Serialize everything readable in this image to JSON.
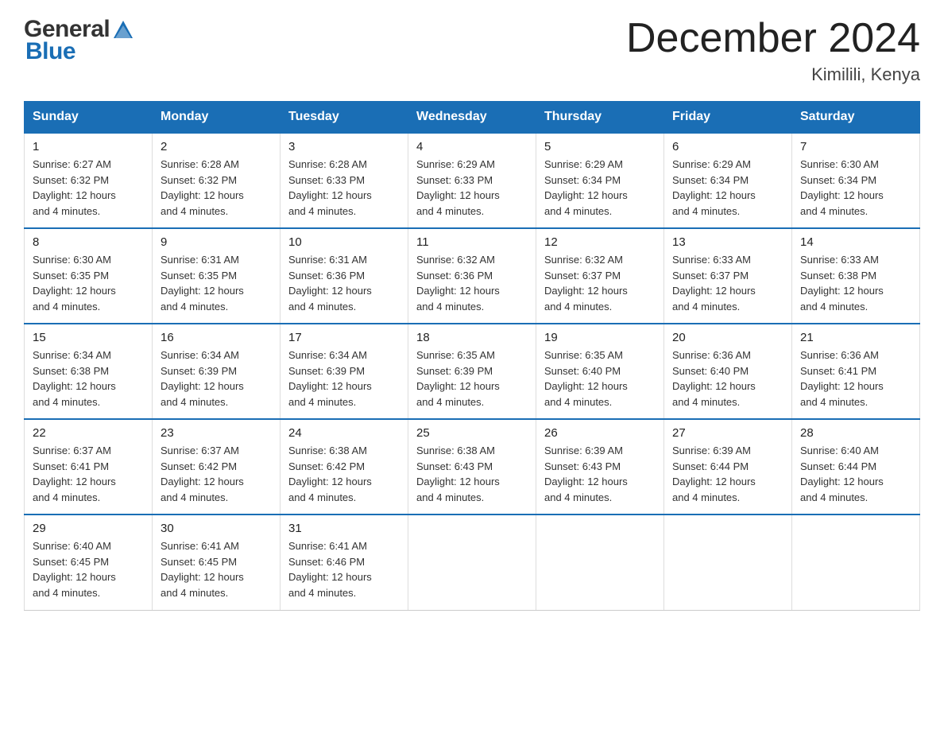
{
  "header": {
    "logo_general": "General",
    "logo_blue": "Blue",
    "month_title": "December 2024",
    "location": "Kimilili, Kenya"
  },
  "days_of_week": [
    "Sunday",
    "Monday",
    "Tuesday",
    "Wednesday",
    "Thursday",
    "Friday",
    "Saturday"
  ],
  "weeks": [
    [
      {
        "day": "1",
        "sunrise": "6:27 AM",
        "sunset": "6:32 PM",
        "daylight": "12 hours and 4 minutes."
      },
      {
        "day": "2",
        "sunrise": "6:28 AM",
        "sunset": "6:32 PM",
        "daylight": "12 hours and 4 minutes."
      },
      {
        "day": "3",
        "sunrise": "6:28 AM",
        "sunset": "6:33 PM",
        "daylight": "12 hours and 4 minutes."
      },
      {
        "day": "4",
        "sunrise": "6:29 AM",
        "sunset": "6:33 PM",
        "daylight": "12 hours and 4 minutes."
      },
      {
        "day": "5",
        "sunrise": "6:29 AM",
        "sunset": "6:34 PM",
        "daylight": "12 hours and 4 minutes."
      },
      {
        "day": "6",
        "sunrise": "6:29 AM",
        "sunset": "6:34 PM",
        "daylight": "12 hours and 4 minutes."
      },
      {
        "day": "7",
        "sunrise": "6:30 AM",
        "sunset": "6:34 PM",
        "daylight": "12 hours and 4 minutes."
      }
    ],
    [
      {
        "day": "8",
        "sunrise": "6:30 AM",
        "sunset": "6:35 PM",
        "daylight": "12 hours and 4 minutes."
      },
      {
        "day": "9",
        "sunrise": "6:31 AM",
        "sunset": "6:35 PM",
        "daylight": "12 hours and 4 minutes."
      },
      {
        "day": "10",
        "sunrise": "6:31 AM",
        "sunset": "6:36 PM",
        "daylight": "12 hours and 4 minutes."
      },
      {
        "day": "11",
        "sunrise": "6:32 AM",
        "sunset": "6:36 PM",
        "daylight": "12 hours and 4 minutes."
      },
      {
        "day": "12",
        "sunrise": "6:32 AM",
        "sunset": "6:37 PM",
        "daylight": "12 hours and 4 minutes."
      },
      {
        "day": "13",
        "sunrise": "6:33 AM",
        "sunset": "6:37 PM",
        "daylight": "12 hours and 4 minutes."
      },
      {
        "day": "14",
        "sunrise": "6:33 AM",
        "sunset": "6:38 PM",
        "daylight": "12 hours and 4 minutes."
      }
    ],
    [
      {
        "day": "15",
        "sunrise": "6:34 AM",
        "sunset": "6:38 PM",
        "daylight": "12 hours and 4 minutes."
      },
      {
        "day": "16",
        "sunrise": "6:34 AM",
        "sunset": "6:39 PM",
        "daylight": "12 hours and 4 minutes."
      },
      {
        "day": "17",
        "sunrise": "6:34 AM",
        "sunset": "6:39 PM",
        "daylight": "12 hours and 4 minutes."
      },
      {
        "day": "18",
        "sunrise": "6:35 AM",
        "sunset": "6:39 PM",
        "daylight": "12 hours and 4 minutes."
      },
      {
        "day": "19",
        "sunrise": "6:35 AM",
        "sunset": "6:40 PM",
        "daylight": "12 hours and 4 minutes."
      },
      {
        "day": "20",
        "sunrise": "6:36 AM",
        "sunset": "6:40 PM",
        "daylight": "12 hours and 4 minutes."
      },
      {
        "day": "21",
        "sunrise": "6:36 AM",
        "sunset": "6:41 PM",
        "daylight": "12 hours and 4 minutes."
      }
    ],
    [
      {
        "day": "22",
        "sunrise": "6:37 AM",
        "sunset": "6:41 PM",
        "daylight": "12 hours and 4 minutes."
      },
      {
        "day": "23",
        "sunrise": "6:37 AM",
        "sunset": "6:42 PM",
        "daylight": "12 hours and 4 minutes."
      },
      {
        "day": "24",
        "sunrise": "6:38 AM",
        "sunset": "6:42 PM",
        "daylight": "12 hours and 4 minutes."
      },
      {
        "day": "25",
        "sunrise": "6:38 AM",
        "sunset": "6:43 PM",
        "daylight": "12 hours and 4 minutes."
      },
      {
        "day": "26",
        "sunrise": "6:39 AM",
        "sunset": "6:43 PM",
        "daylight": "12 hours and 4 minutes."
      },
      {
        "day": "27",
        "sunrise": "6:39 AM",
        "sunset": "6:44 PM",
        "daylight": "12 hours and 4 minutes."
      },
      {
        "day": "28",
        "sunrise": "6:40 AM",
        "sunset": "6:44 PM",
        "daylight": "12 hours and 4 minutes."
      }
    ],
    [
      {
        "day": "29",
        "sunrise": "6:40 AM",
        "sunset": "6:45 PM",
        "daylight": "12 hours and 4 minutes."
      },
      {
        "day": "30",
        "sunrise": "6:41 AM",
        "sunset": "6:45 PM",
        "daylight": "12 hours and 4 minutes."
      },
      {
        "day": "31",
        "sunrise": "6:41 AM",
        "sunset": "6:46 PM",
        "daylight": "12 hours and 4 minutes."
      },
      null,
      null,
      null,
      null
    ]
  ],
  "labels": {
    "sunrise": "Sunrise:",
    "sunset": "Sunset:",
    "daylight": "Daylight:"
  },
  "colors": {
    "header_bg": "#1a6eb5",
    "header_text": "#ffffff",
    "border_top": "#1a6eb5"
  }
}
